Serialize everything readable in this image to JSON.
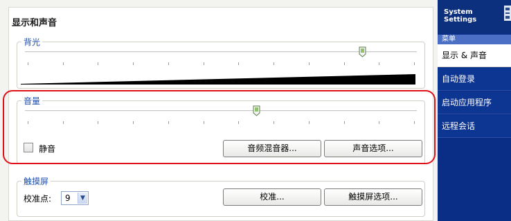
{
  "page": {
    "title": "显示和声音"
  },
  "backlight": {
    "legend": "背光",
    "level": 0.86
  },
  "volume": {
    "legend": "音量",
    "level": 0.59
  },
  "mute": {
    "label": "静音",
    "checked": false
  },
  "buttons": {
    "mixer": "音频混音器...",
    "sound_options": "声音选项...",
    "calibrate": "校准...",
    "touch_options": "触摸屏选项..."
  },
  "touchscreen": {
    "legend": "触摸屏",
    "cal_points_label": "校准点:",
    "cal_points_value": "9"
  },
  "sidebar": {
    "title_line1": "System",
    "title_line2": "Settings",
    "menu_label": "菜单",
    "items": [
      {
        "label": "显示 & 声音",
        "active": true
      },
      {
        "label": "自动登录",
        "active": false
      },
      {
        "label": "启动应用程序",
        "active": false
      },
      {
        "label": "远程会话",
        "active": false
      }
    ]
  },
  "colors": {
    "highlight": "#e0101a",
    "sidebar_bg": "#0a2e86",
    "legend_text": "#1f4eaa"
  }
}
